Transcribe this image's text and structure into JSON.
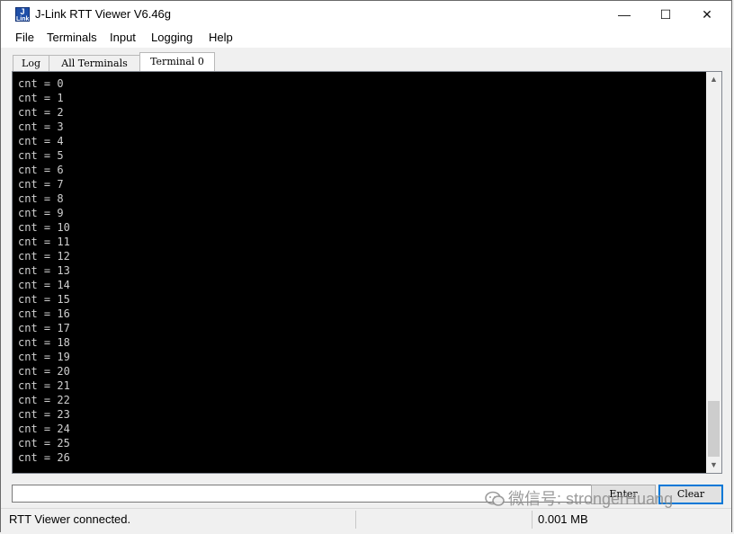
{
  "window": {
    "title": "J-Link RTT Viewer V6.46g",
    "app_icon_text": [
      "J",
      "Link"
    ],
    "controls": {
      "minimize": "—",
      "maximize": "☐",
      "close": "✕"
    }
  },
  "menu": {
    "file": "File",
    "terminals": "Terminals",
    "input": "Input",
    "logging": "Logging",
    "help": "Help"
  },
  "tabs": {
    "log": "Log",
    "all_terminals": "All Terminals",
    "terminal0": "Terminal 0"
  },
  "terminal": {
    "background": "#000000",
    "text_color": "#cfcfcf",
    "lines": [
      "cnt = 0",
      "cnt = 1",
      "cnt = 2",
      "cnt = 3",
      "cnt = 4",
      "cnt = 5",
      "cnt = 6",
      "cnt = 7",
      "cnt = 8",
      "cnt = 9",
      "cnt = 10",
      "cnt = 11",
      "cnt = 12",
      "cnt = 13",
      "cnt = 14",
      "cnt = 15",
      "cnt = 16",
      "cnt = 17",
      "cnt = 18",
      "cnt = 19",
      "cnt = 20",
      "cnt = 21",
      "cnt = 22",
      "cnt = 23",
      "cnt = 24",
      "cnt = 25",
      "cnt = 26"
    ]
  },
  "input": {
    "value": ""
  },
  "buttons": {
    "enter": "Enter",
    "clear": "Clear"
  },
  "status": {
    "message": "RTT Viewer connected.",
    "data_size": "0.001 MB"
  },
  "watermark": {
    "text": "微信号: strongerHuang"
  },
  "colors": {
    "focus_blue": "#0078d7",
    "scroll_thumb": "#cdcdcd"
  }
}
